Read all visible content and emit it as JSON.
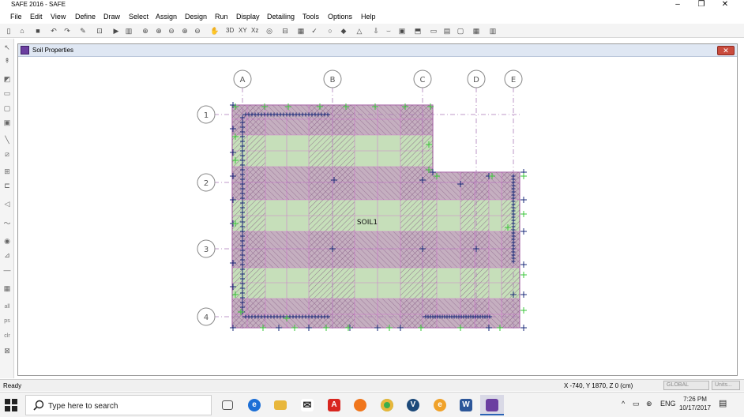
{
  "window": {
    "title": "SAFE 2016 - SAFE",
    "minimize": "–",
    "restore": "❐",
    "close": "✕"
  },
  "menu": [
    "File",
    "Edit",
    "View",
    "Define",
    "Draw",
    "Select",
    "Assign",
    "Design",
    "Run",
    "Display",
    "Detailing",
    "Tools",
    "Options",
    "Help"
  ],
  "toolbar": {
    "view_3d": "3D",
    "view_xy": "XY",
    "view_xz": "Xz"
  },
  "left_toolbar": {
    "all": "all",
    "ps": "ps",
    "clr": "clr"
  },
  "child_window": {
    "title": "Soil Properties",
    "close": "✕"
  },
  "plot": {
    "grid_columns": [
      "A",
      "B",
      "C",
      "D",
      "E"
    ],
    "grid_rows": [
      "1",
      "2",
      "3",
      "4"
    ],
    "soil_label": "SOIL1",
    "colors": {
      "slab_magenta": "#c486c4",
      "soil_green": "#c6dfba",
      "hatch": "#7a4d7a",
      "gridline": "#aa7ab7",
      "support_blue": "#1a2a7a",
      "support_green": "#39c539",
      "bubble": "#888888"
    }
  },
  "status": {
    "ready": "Ready",
    "coords": "X -740,  Y 1870,  Z 0   (cm)",
    "coord_system": "GLOBAL",
    "units": "Units..."
  },
  "taskbar": {
    "search_placeholder": "Type here to search",
    "apps": [
      "task-view",
      "edge",
      "file-explorer",
      "mail",
      "acrobat",
      "firefox",
      "chrome",
      "vstudio",
      "eclipse",
      "word",
      "safe"
    ],
    "app_letters": [
      "",
      "e",
      "",
      "✉",
      "A",
      "",
      "",
      "V",
      "e",
      "W",
      ""
    ],
    "language": "ENG",
    "time": "7:26 PM",
    "date": "10/17/2017"
  }
}
